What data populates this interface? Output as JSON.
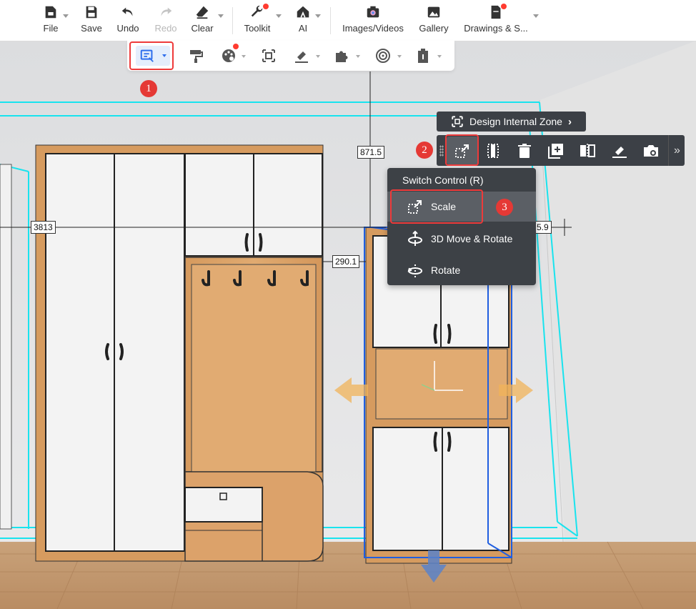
{
  "toolbar": {
    "file": "File",
    "save": "Save",
    "undo": "Undo",
    "redo": "Redo",
    "clear": "Clear",
    "toolkit": "Toolkit",
    "ai": "AI",
    "images_videos": "Images/Videos",
    "gallery": "Gallery",
    "drawings": "Drawings & S..."
  },
  "annotations": {
    "step1": "1",
    "step2": "2",
    "step3": "3"
  },
  "dimensions": {
    "height_label": "871.5",
    "width_label": "3813",
    "side_label": "290.1",
    "right_label": "5.9"
  },
  "panel": {
    "design_zone": "Design Internal Zone",
    "menu_title": "Switch Control (R)",
    "items": [
      "Scale",
      "3D Move & Rotate",
      "Rotate"
    ]
  },
  "colors": {
    "accent": "#2f6fed",
    "dark_panel": "#3c4046",
    "highlight": "#ee3a3a",
    "wood": "#d9a066",
    "wireframe": "#19e3ee"
  }
}
